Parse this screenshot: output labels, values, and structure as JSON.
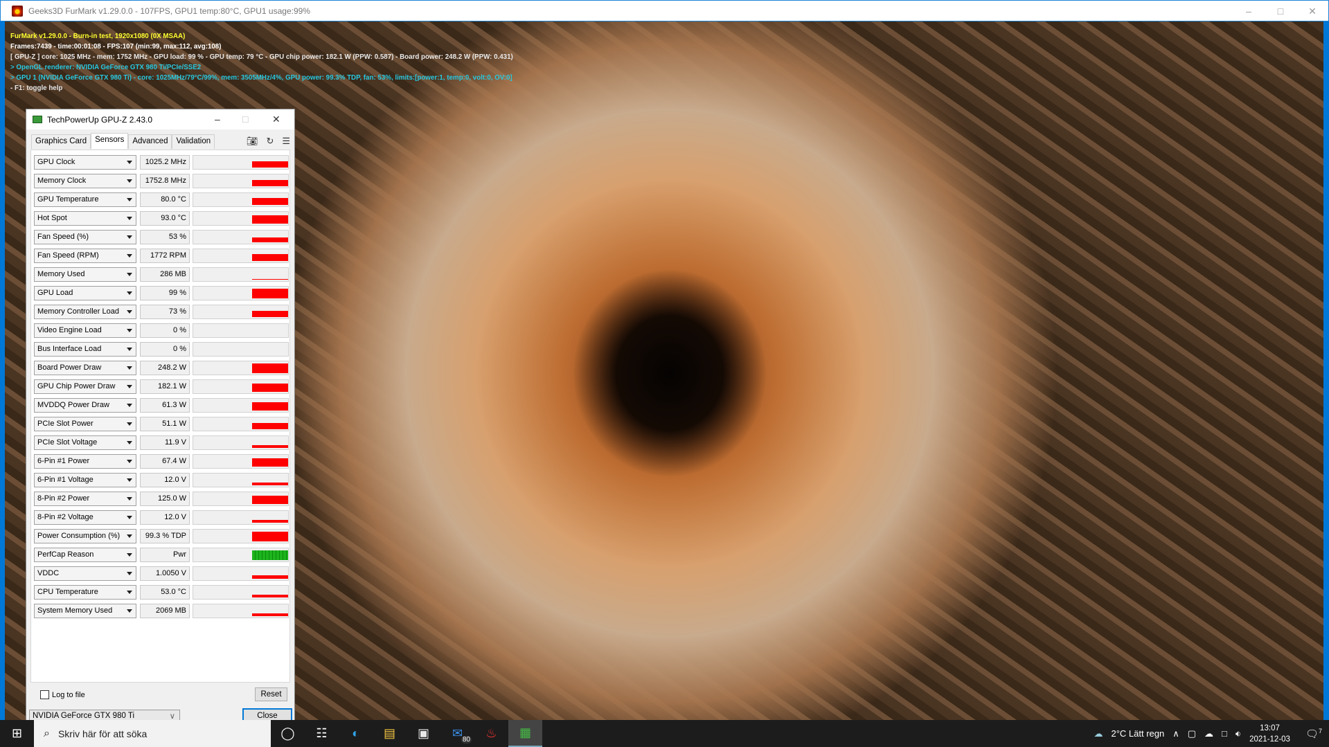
{
  "window": {
    "title": "Geeks3D FurMark v1.29.0.0 - 107FPS, GPU1 temp:80°C, GPU1 usage:99%"
  },
  "osd": {
    "line1": "FurMark v1.29.0.0 - Burn-in test, 1920x1080 (0X MSAA)",
    "line2": "Frames:7439 - time:00:01:08 - FPS:107 (min:99, max:112, avg:108)",
    "line3": "[ GPU-Z ] core: 1025 MHz - mem: 1752 MHz - GPU load: 99 % - GPU temp: 79 °C - GPU chip power: 182.1 W (PPW: 0.587) - Board power: 248.2 W (PPW: 0.431)",
    "line4": "> OpenGL renderer: NVIDIA GeForce GTX 980 Ti/PCIe/SSE2",
    "line5": "> GPU 1 (NVIDIA GeForce GTX 980 Ti) - core: 1025MHz/79°C/99%, mem: 3505MHz/4%, GPU power: 99.3% TDP, fan: 53%, limits:[power:1, temp:0, volt:0, OV:0]",
    "line6": "- F1: toggle help"
  },
  "gpuz": {
    "title": "TechPowerUp GPU-Z 2.43.0",
    "tabs": [
      "Graphics Card",
      "Sensors",
      "Advanced",
      "Validation"
    ],
    "active_tab": "Sensors",
    "sensors": [
      {
        "name": "GPU Clock",
        "value": "1025.2 MHz",
        "level": 0.55
      },
      {
        "name": "Memory Clock",
        "value": "1752.8 MHz",
        "level": 0.5
      },
      {
        "name": "GPU Temperature",
        "value": "80.0 °C",
        "level": 0.6
      },
      {
        "name": "Hot Spot",
        "value": "93.0 °C",
        "level": 0.7
      },
      {
        "name": "Fan Speed (%)",
        "value": "53 %",
        "level": 0.4
      },
      {
        "name": "Fan Speed (RPM)",
        "value": "1772 RPM",
        "level": 0.6
      },
      {
        "name": "Memory Used",
        "value": "286 MB",
        "level": 0.05
      },
      {
        "name": "GPU Load",
        "value": "99 %",
        "level": 0.85
      },
      {
        "name": "Memory Controller Load",
        "value": "73 %",
        "level": 0.55
      },
      {
        "name": "Video Engine Load",
        "value": "0 %",
        "level": 0
      },
      {
        "name": "Bus Interface Load",
        "value": "0 %",
        "level": 0
      },
      {
        "name": "Board Power Draw",
        "value": "248.2 W",
        "level": 0.8
      },
      {
        "name": "GPU Chip Power Draw",
        "value": "182.1 W",
        "level": 0.7
      },
      {
        "name": "MVDDQ Power Draw",
        "value": "61.3 W",
        "level": 0.7
      },
      {
        "name": "PCIe Slot Power",
        "value": "51.1 W",
        "level": 0.5
      },
      {
        "name": "PCIe Slot Voltage",
        "value": "11.9 V",
        "level": 0.25
      },
      {
        "name": "6-Pin #1 Power",
        "value": "67.4 W",
        "level": 0.7
      },
      {
        "name": "6-Pin #1 Voltage",
        "value": "12.0 V",
        "level": 0.25
      },
      {
        "name": "8-Pin #2 Power",
        "value": "125.0 W",
        "level": 0.7
      },
      {
        "name": "8-Pin #2 Voltage",
        "value": "12.0 V",
        "level": 0.25
      },
      {
        "name": "Power Consumption (%)",
        "value": "99.3 % TDP",
        "level": 0.8
      },
      {
        "name": "PerfCap Reason",
        "value": "Pwr",
        "level": 0.8,
        "color": "green"
      },
      {
        "name": "VDDC",
        "value": "1.0050 V",
        "level": 0.3
      },
      {
        "name": "CPU Temperature",
        "value": "53.0 °C",
        "level": 0.25
      },
      {
        "name": "System Memory Used",
        "value": "2069 MB",
        "level": 0.25
      }
    ],
    "log_label": "Log to file",
    "reset_label": "Reset",
    "device": "NVIDIA GeForce GTX 980 Ti",
    "close_label": "Close"
  },
  "taskbar": {
    "search_placeholder": "Skriv här för att söka",
    "mail_badge": "80",
    "weather": "2°C  Lätt regn",
    "time": "13:07",
    "date": "2021-12-03",
    "notifications": "7"
  }
}
